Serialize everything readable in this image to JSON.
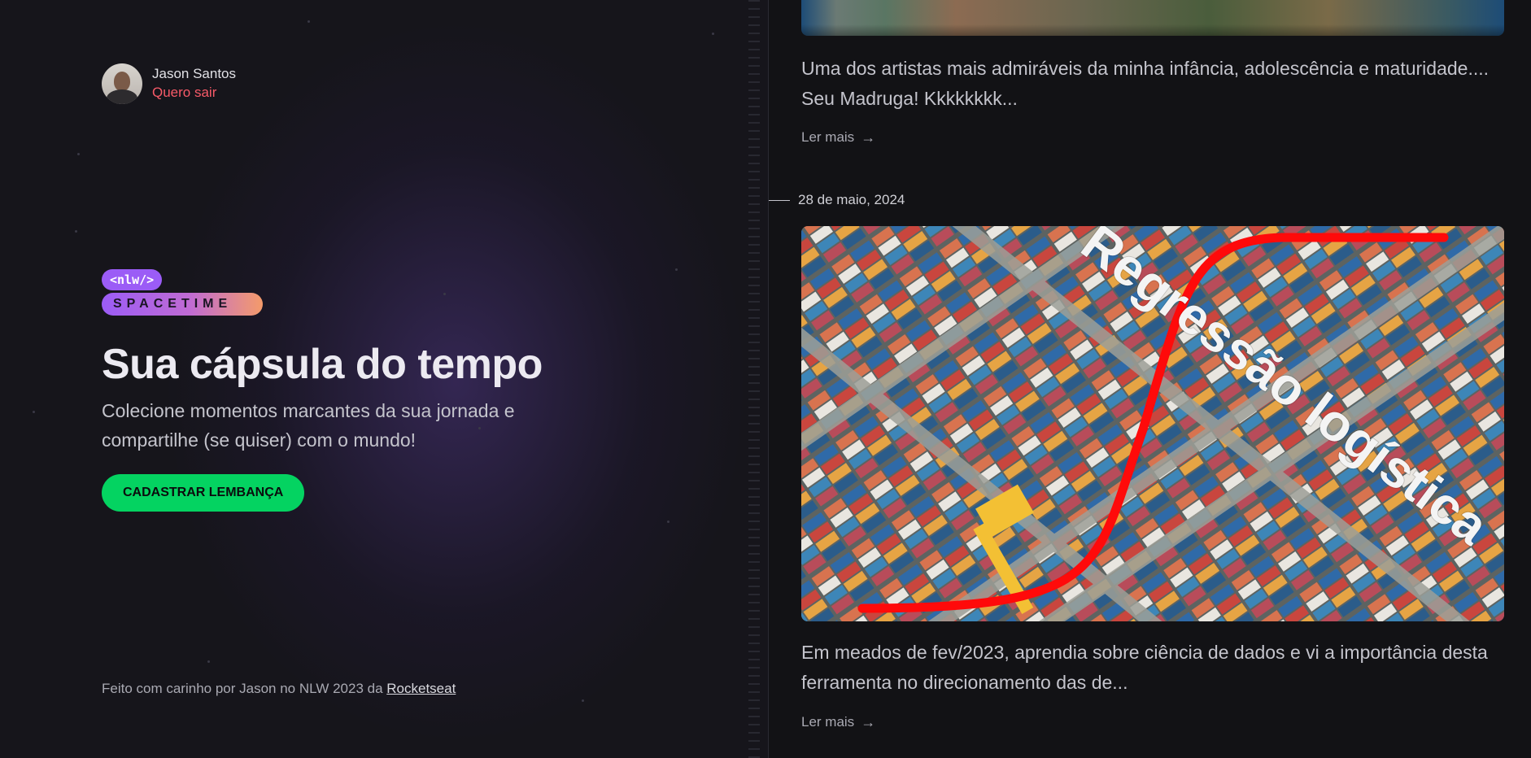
{
  "user": {
    "name": "Jason Santos",
    "logout_label": "Quero sair"
  },
  "logo": {
    "tag": "<nlw/>",
    "word": "SPACETIME"
  },
  "hero": {
    "title": "Sua cápsula do tempo",
    "subtitle": "Colecione momentos marcantes da sua jornada e compartilhe (se quiser) com o mundo!",
    "cta_label": "CADASTRAR LEMBANÇA"
  },
  "footer": {
    "text": "Feito com carinho por Jason no NLW 2023 da ",
    "link_label": "Rocketseat"
  },
  "memories": [
    {
      "excerpt": "Uma dos artistas mais admiráveis da minha infância, adolescência e maturidade.... Seu Madruga! Kkkkkkkk...",
      "read_more": "Ler mais"
    },
    {
      "date": "28 de maio, 2024",
      "image_caption": "Regressão logística",
      "excerpt": "Em meados de fev/2023, aprendia sobre ciência de dados e vi a importância desta ferramenta no direcionamento das de...",
      "read_more": "Ler mais"
    }
  ],
  "colors": {
    "accent_green": "#04d361",
    "logout_red": "#f75a68",
    "brand_purple": "#9b5cf6"
  },
  "icons": {
    "read_more": "arrow-right-icon"
  }
}
